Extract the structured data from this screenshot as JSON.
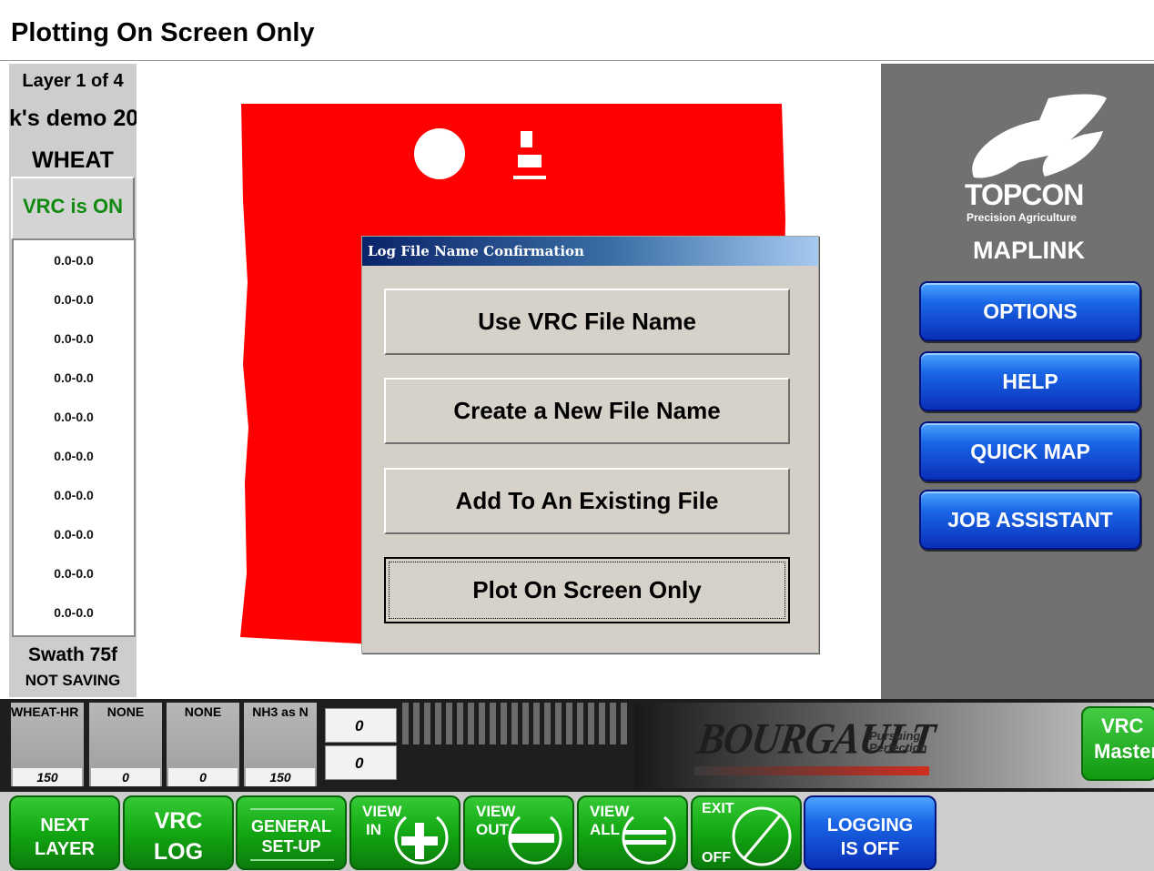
{
  "title": "Plotting On Screen Only",
  "left_panel": {
    "layer": "Layer 1 of 4",
    "job": "k's demo 20",
    "crop": "WHEAT",
    "vrc_status": "VRC is ON",
    "rates": [
      "0.0-0.0",
      "0.0-0.0",
      "0.0-0.0",
      "0.0-0.0",
      "0.0-0.0",
      "0.0-0.0",
      "0.0-0.0",
      "0.0-0.0",
      "0.0-0.0",
      "0.0-0.0"
    ],
    "swath": "Swath 75f",
    "saving": "NOT SAVING"
  },
  "map": {
    "coverage_color": "#ff0000"
  },
  "dialog": {
    "title": "Log File Name Confirmation",
    "buttons": [
      "Use VRC File Name",
      "Create a New File Name",
      "Add To An Existing File",
      "Plot On Screen Only"
    ]
  },
  "right_panel": {
    "logo_word": "TOPCON",
    "logo_sub": "Precision Agriculture",
    "product": "MAPLINK",
    "buttons": [
      "OPTIONS",
      "HELP",
      "QUICK MAP",
      "JOB ASSISTANT"
    ]
  },
  "status": {
    "tanks": [
      {
        "name": "WHEAT-HR",
        "value": "150"
      },
      {
        "name": "NONE",
        "value": "0"
      },
      {
        "name": "NONE",
        "value": "0"
      },
      {
        "name": "NH3 as N",
        "value": "150"
      }
    ],
    "counters": [
      "0",
      "0"
    ],
    "brand": "BOURGAULT",
    "tagline_1": "Pursuing",
    "tagline_2": "Perfection",
    "vrc_master_1": "VRC",
    "vrc_master_2": "Master"
  },
  "bottom_buttons": {
    "next_layer_1": "NEXT",
    "next_layer_2": "LAYER",
    "vrc_log_1": "VRC",
    "vrc_log_2": "LOG",
    "general_1": "GENERAL",
    "general_2": "SET-UP",
    "view_in_1": "VIEW",
    "view_in_2": "IN",
    "view_out_1": "VIEW",
    "view_out_2": "OUT",
    "view_all_1": "VIEW",
    "view_all_2": "ALL",
    "exit_1": "EXIT",
    "exit_2": "OFF",
    "logging_1": "LOGGING",
    "logging_2": "IS OFF"
  },
  "colors": {
    "green": "#13a713",
    "blue": "#0a2fb8",
    "red": "#ff0000",
    "panel_gray": "#717171"
  }
}
